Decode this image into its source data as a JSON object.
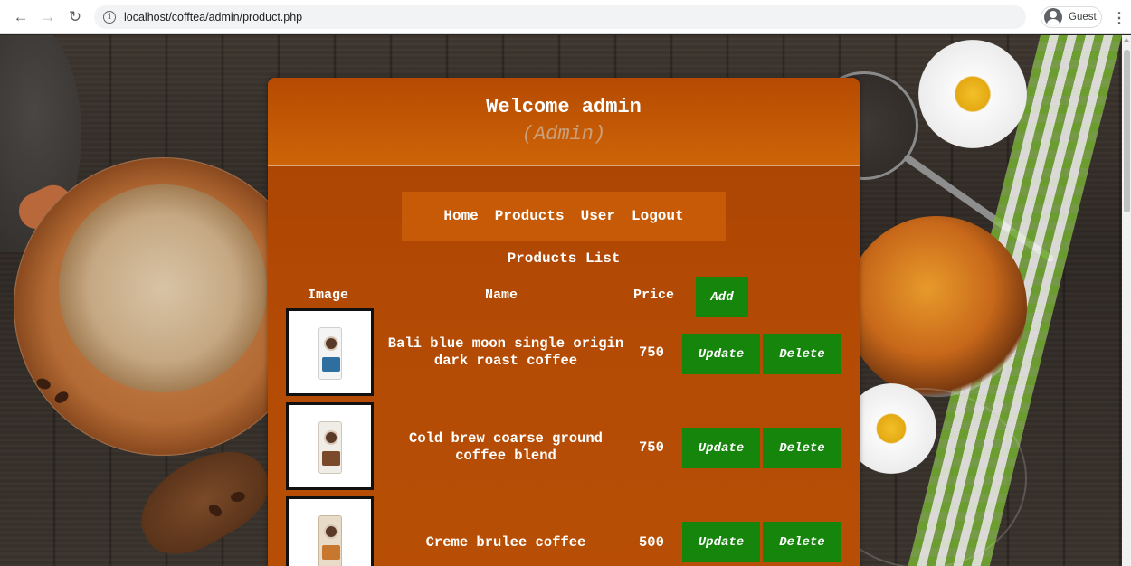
{
  "browser": {
    "url": "localhost/cofftea/admin/product.php",
    "profile_label": "Guest"
  },
  "colors": {
    "panel": "#b24a05",
    "menu_bg": "#c75a06",
    "button_green": "#15860b",
    "role_text": "#c9a07b"
  },
  "header": {
    "welcome": "Welcome admin",
    "role": "(Admin)"
  },
  "nav": {
    "items": [
      {
        "label": "Home"
      },
      {
        "label": "Products"
      },
      {
        "label": "User"
      },
      {
        "label": "Logout"
      }
    ]
  },
  "products": {
    "title": "Products List",
    "columns": {
      "image": "Image",
      "name": "Name",
      "price": "Price"
    },
    "add_label": "Add",
    "update_label": "Update",
    "delete_label": "Delete",
    "rows": [
      {
        "name": "Bali blue moon single origin dark roast coffee",
        "price": "750"
      },
      {
        "name": "Cold brew coarse ground coffee blend",
        "price": "750"
      },
      {
        "name": "Creme brulee coffee",
        "price": "500"
      }
    ]
  }
}
